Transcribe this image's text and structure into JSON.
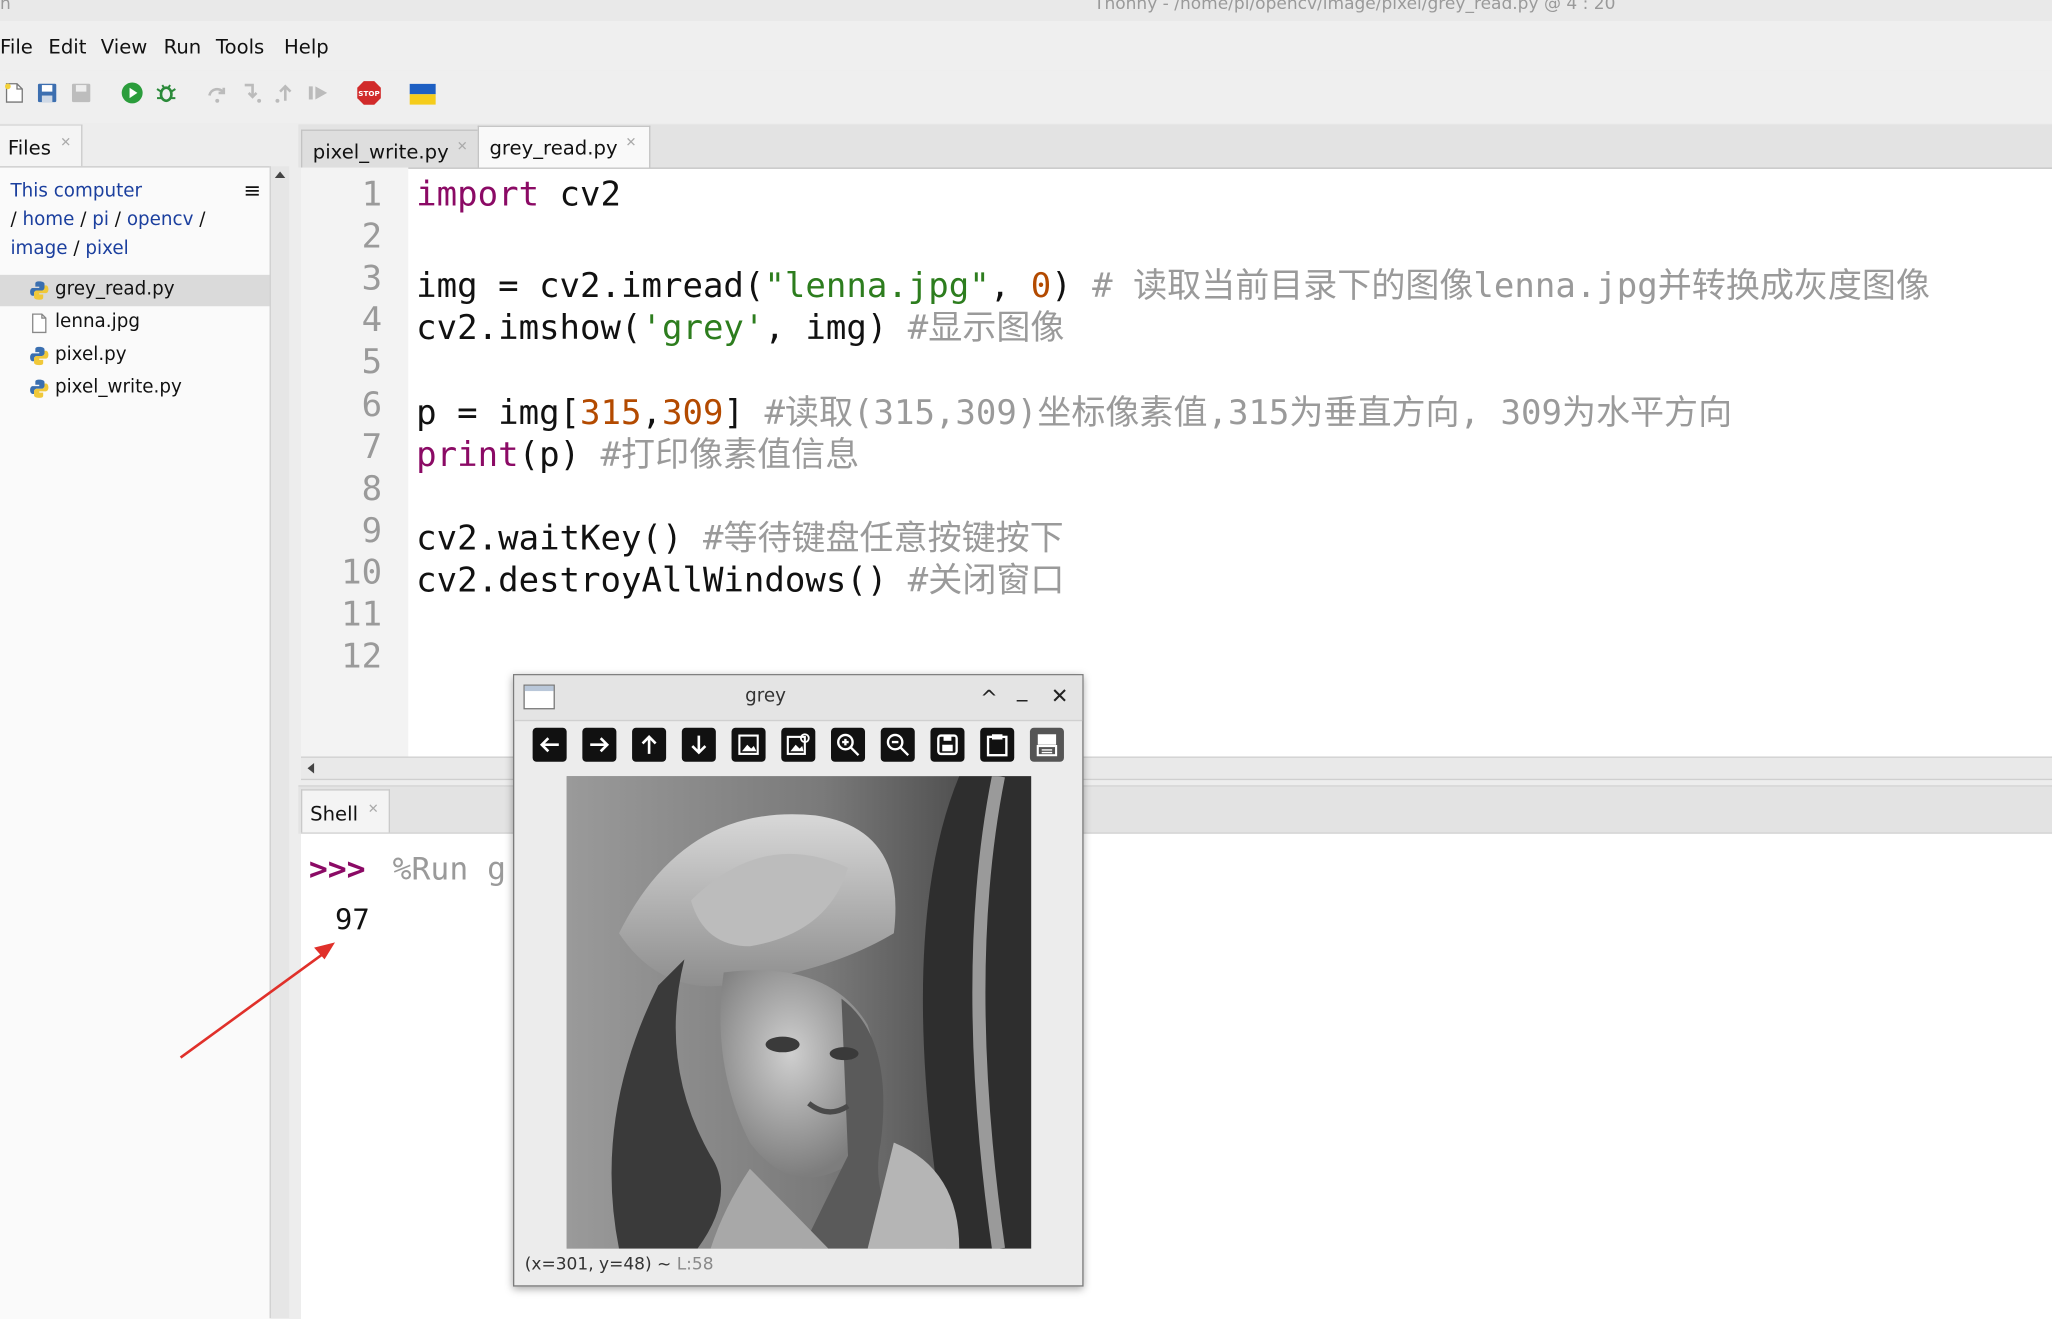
{
  "window": {
    "title_left": "h",
    "title": "Thonny  -  /home/pi/opencv/image/pixel/grey_read.py  @  4 : 20"
  },
  "menu": [
    "File",
    "Edit",
    "View",
    "Run",
    "Tools",
    "Help"
  ],
  "toolbar": {
    "icons": [
      "new-file-icon",
      "save-icon",
      "save-all-icon",
      "run-icon",
      "debug-icon",
      "step-over-icon",
      "step-into-icon",
      "step-out-icon",
      "resume-icon",
      "stop-icon",
      "ukraine-flag-icon"
    ],
    "stop_label": "STOP"
  },
  "files": {
    "tab_label": "Files",
    "location": {
      "computer": "This computer",
      "path": [
        {
          "label": "home"
        },
        {
          "label": "pi"
        },
        {
          "label": "opencv"
        },
        {
          "label": "image"
        },
        {
          "label": "pixel"
        }
      ],
      "sep": " / "
    },
    "items": [
      {
        "name": "grey_read.py",
        "type": "python",
        "selected": true
      },
      {
        "name": "lenna.jpg",
        "type": "file",
        "selected": false
      },
      {
        "name": "pixel.py",
        "type": "python",
        "selected": false
      },
      {
        "name": "pixel_write.py",
        "type": "python",
        "selected": false
      }
    ],
    "menu_icon": "≡"
  },
  "editor": {
    "tabs": [
      {
        "label": "pixel_write.py",
        "active": false
      },
      {
        "label": "grey_read.py",
        "active": true
      }
    ],
    "lines": [
      {
        "n": "1",
        "parts": [
          {
            "t": "import",
            "c": "kw"
          },
          {
            "t": " cv2",
            "c": ""
          }
        ]
      },
      {
        "n": "2",
        "parts": []
      },
      {
        "n": "3",
        "parts": [
          {
            "t": "img = cv2.imread(",
            "c": ""
          },
          {
            "t": "\"lenna.jpg\"",
            "c": "str"
          },
          {
            "t": ", ",
            "c": ""
          },
          {
            "t": "0",
            "c": "num"
          },
          {
            "t": ") ",
            "c": ""
          },
          {
            "t": "# 读取当前目录下的图像lenna.jpg并转换成灰度图像",
            "c": "cm"
          }
        ]
      },
      {
        "n": "4",
        "parts": [
          {
            "t": "cv2.imshow(",
            "c": ""
          },
          {
            "t": "'grey'",
            "c": "str"
          },
          {
            "t": ", img) ",
            "c": ""
          },
          {
            "t": "#显示图像",
            "c": "cm"
          }
        ]
      },
      {
        "n": "5",
        "parts": []
      },
      {
        "n": "6",
        "parts": [
          {
            "t": "p = img[",
            "c": ""
          },
          {
            "t": "315",
            "c": "num"
          },
          {
            "t": ",",
            "c": ""
          },
          {
            "t": "309",
            "c": "num"
          },
          {
            "t": "] ",
            "c": ""
          },
          {
            "t": "#读取(315,309)坐标像素值,315为垂直方向, 309为水平方向",
            "c": "cm"
          }
        ]
      },
      {
        "n": "7",
        "parts": [
          {
            "t": "print",
            "c": "kw"
          },
          {
            "t": "(p) ",
            "c": ""
          },
          {
            "t": "#打印像素值信息",
            "c": "cm"
          }
        ]
      },
      {
        "n": "8",
        "parts": []
      },
      {
        "n": "9",
        "parts": [
          {
            "t": "cv2.waitKey() ",
            "c": ""
          },
          {
            "t": "#等待键盘任意按键按下",
            "c": "cm"
          }
        ]
      },
      {
        "n": "10",
        "parts": [
          {
            "t": "cv2.destroyAllWindows() ",
            "c": ""
          },
          {
            "t": "#关闭窗口",
            "c": "cm"
          }
        ]
      },
      {
        "n": "11",
        "parts": []
      },
      {
        "n": "12",
        "parts": []
      }
    ]
  },
  "shell": {
    "tab_label": "Shell",
    "prompt": ">>>",
    "command": "%Run g",
    "output": "97"
  },
  "image_window": {
    "title": "grey",
    "controls": {
      "up": "^",
      "minimize": "_",
      "close": "✕"
    },
    "buttons": [
      "arrow-left-icon",
      "arrow-right-icon",
      "arrow-up-icon",
      "arrow-down-icon",
      "zoom-fit-icon",
      "zoom-original-icon",
      "zoom-in-icon",
      "zoom-out-icon",
      "save-image-icon",
      "copy-clipboard-icon",
      "properties-icon"
    ],
    "status_coords": "(x=301, y=48) ~ ",
    "status_lum": "L:58"
  },
  "annotation": {
    "color": "#e0302a"
  }
}
